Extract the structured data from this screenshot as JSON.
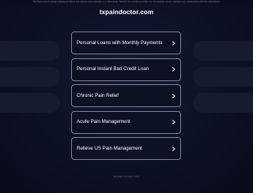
{
  "top_notice": "The Sponsored Listings displayed above are served automatically by a third party. Neither the service provider nor the domain owner maintain any relationship with the advertisers.",
  "domain": "txpaindoctor.com",
  "links": [
    {
      "label": "Personal Loans with Monthly Payments",
      "icon": "chevron-right-icon"
    },
    {
      "label": "Personal Instant Bad Credit Loan",
      "icon": "chevron-right-icon"
    },
    {
      "label": "Chronic Pain Relief",
      "icon": "chevron-right-icon"
    },
    {
      "label": "Acute Pain Management",
      "icon": "chevron-right-icon"
    },
    {
      "label": "Relieve US Pain Management",
      "icon": "chevron-right-icon"
    }
  ],
  "footer": "Copyright | Privacy Policy",
  "colors": {
    "background": "#0c1024",
    "link_border": "#7c8196",
    "text": "#ffffff"
  }
}
